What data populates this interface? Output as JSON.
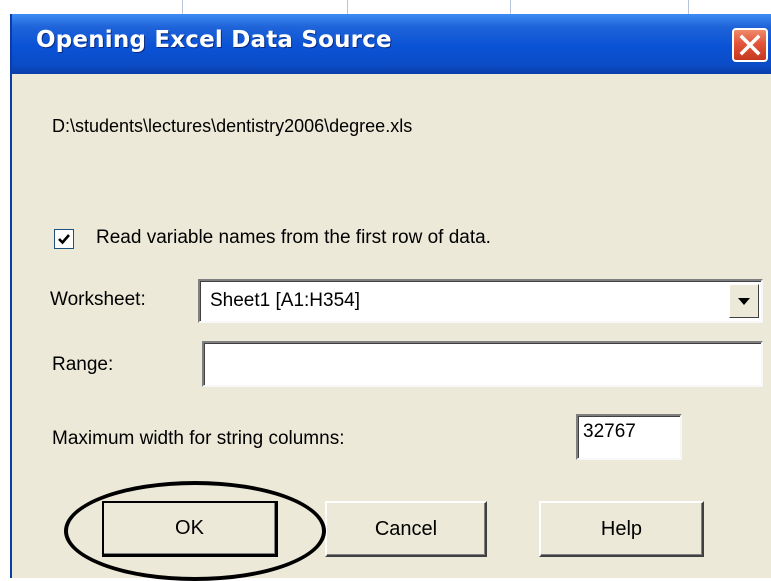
{
  "dialog": {
    "title": "Opening Excel Data Source",
    "file_path": "D:\\students\\lectures\\dentistry2006\\degree.xls",
    "read_names_checkbox": {
      "label": "Read variable names from the first row of data.",
      "checked": true
    },
    "worksheet": {
      "label": "Worksheet:",
      "value": "Sheet1  [A1:H354]"
    },
    "range": {
      "label": "Range:",
      "value": ""
    },
    "max_width": {
      "label": "Maximum width for string columns:",
      "value": "32767"
    },
    "buttons": {
      "ok": "OK",
      "cancel": "Cancel",
      "help": "Help"
    }
  },
  "colors": {
    "titlebar": "#0a52d6",
    "dialog_bg": "#ece9d8",
    "close_button": "#e2553a"
  },
  "icons": {
    "close": "close-icon",
    "checkmark": "checkmark-icon",
    "dropdown": "chevron-down-icon"
  }
}
